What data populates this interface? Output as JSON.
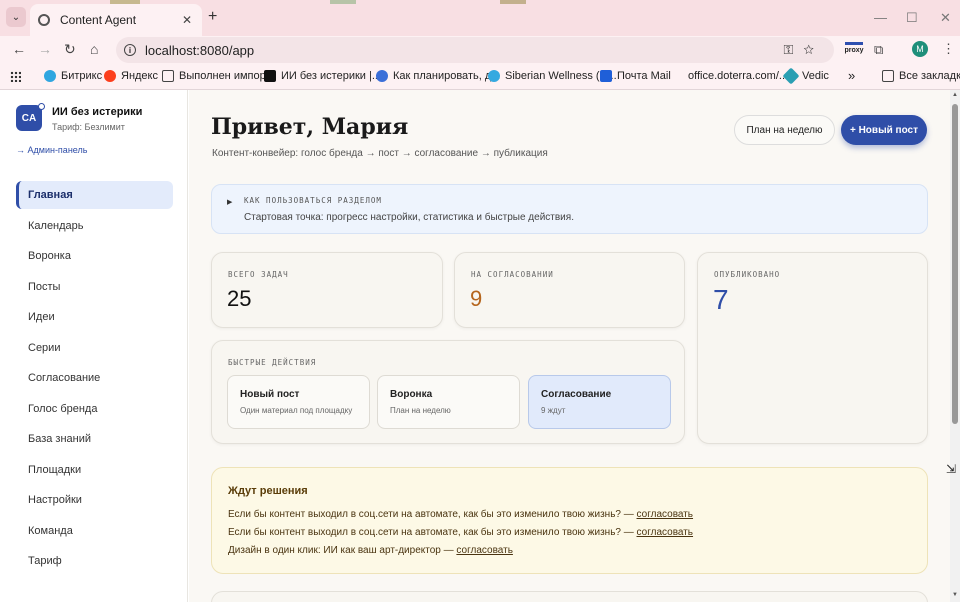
{
  "browser": {
    "tab_title": "Content Agent",
    "tab_close": "✕",
    "new_tab": "+",
    "tab_menu": "⌄",
    "url": "localhost:8080/app",
    "proxy_label": "proxy",
    "profile_initial": "M",
    "window": {
      "minimize": "—",
      "maximize": "☐",
      "close": "✕"
    },
    "bookmarks": [
      {
        "label": "Битрикс",
        "color": "#2fa6e0"
      },
      {
        "label": "Яндекс",
        "color": "#fc3f1d"
      },
      {
        "label": "Выполнен импорт",
        "color": "#ffffff"
      },
      {
        "label": "ИИ без истерики |...",
        "color": "#111111"
      },
      {
        "label": "Как планировать, д...",
        "color": "#3b6fd8"
      },
      {
        "label": "Siberian Wellness (С...",
        "color": "#35a9e0"
      },
      {
        "label": "Почта Mail",
        "color": "#1f5fd8"
      },
      {
        "label": "office.doterra.com/...",
        "color": ""
      },
      {
        "label": "Vedic",
        "color": "#2b9fb3"
      }
    ],
    "more": "»",
    "all_bookmarks": "Все закладки"
  },
  "sidebar": {
    "avatar_initials": "CA",
    "org_name": "ИИ без истерики",
    "plan": "Тариф: Безлимит",
    "admin_link": "→ Админ-панель",
    "items": [
      {
        "label": "Главная",
        "active": true
      },
      {
        "label": "Календарь"
      },
      {
        "label": "Воронка"
      },
      {
        "label": "Посты"
      },
      {
        "label": "Идеи"
      },
      {
        "label": "Серии"
      },
      {
        "label": "Согласование"
      },
      {
        "label": "Голос бренда"
      },
      {
        "label": "База знаний"
      },
      {
        "label": "Площадки"
      },
      {
        "label": "Настройки"
      },
      {
        "label": "Команда"
      },
      {
        "label": "Тариф"
      }
    ]
  },
  "header": {
    "title": "Привет, Мария",
    "subtitle": "Контент-конвейер: голос бренда → пост → согласование → публикация",
    "plan_button": "План на неделю",
    "new_post_button": "+ Новый пост"
  },
  "howto": {
    "arrow": "▶",
    "title": "КАК ПОЛЬЗОВАТЬСЯ РАЗДЕЛОМ",
    "text": "Стартовая точка: прогресс настройки, статистика и быстрые действия."
  },
  "stats": {
    "total": {
      "label": "ВСЕГО ЗАДАЧ",
      "value": "25",
      "color": "#111111"
    },
    "review": {
      "label": "НА СОГЛАСОВАНИИ",
      "value": "9",
      "color": "#b5651d"
    },
    "published": {
      "label": "ОПУБЛИКОВАНО",
      "value": "7",
      "color": "#2f4ea8"
    }
  },
  "quick_actions": {
    "label": "БЫСТРЫЕ ДЕЙСТВИЯ",
    "items": [
      {
        "title": "Новый пост",
        "sub": "Один материал под площадку"
      },
      {
        "title": "Воронка",
        "sub": "План на неделю"
      },
      {
        "title": "Согласование",
        "sub": "9 ждут"
      }
    ]
  },
  "pending": {
    "title": "Ждут решения",
    "link_label": "согласовать",
    "items": [
      {
        "text": "Если бы контент выходил в соц.сети на автомате, как бы это изменило твою жизнь? — "
      },
      {
        "text": "Если бы контент выходил в соц.сети на автомате, как бы это изменило твою жизнь? — "
      },
      {
        "text": "Дизайн в один клик: ИИ как ваш арт-директор — "
      }
    ]
  }
}
